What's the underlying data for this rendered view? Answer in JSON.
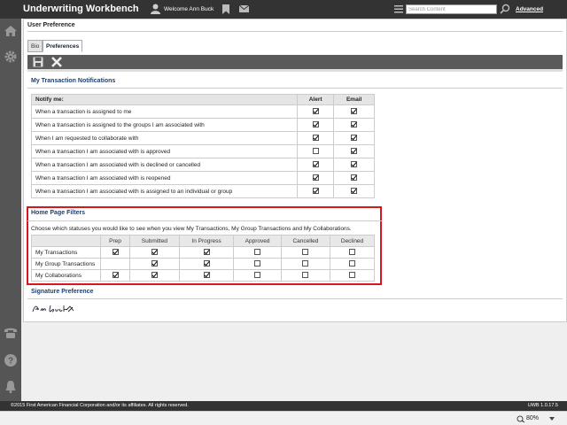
{
  "header": {
    "app_title": "Underwriting Workbench",
    "welcome": "Welcome Ann Buck",
    "search_placeholder": "Search Content",
    "advanced_label": "Advanced"
  },
  "nav_icons": [
    "home-icon",
    "gear-icon",
    "phone-icon",
    "help-icon",
    "bell-icon"
  ],
  "page": {
    "title": "User Preference",
    "tabs": [
      {
        "label": "Bio",
        "active": false
      },
      {
        "label": "Preferences",
        "active": true
      }
    ]
  },
  "notifications": {
    "title": "My Transaction Notifications",
    "headers": {
      "notify": "Notify me:",
      "alert": "Alert",
      "email": "Email"
    },
    "rows": [
      {
        "label": "When a transaction is assigned to me",
        "alert": true,
        "email": true
      },
      {
        "label": "When a transaction is assigned to the groups I am associated with",
        "alert": true,
        "email": true
      },
      {
        "label": "When I am requested to collaborate with",
        "alert": true,
        "email": true
      },
      {
        "label": "When a transaction I am associated with is approved",
        "alert": false,
        "email": true
      },
      {
        "label": "When a transaction I am associated with is declined or cancelled",
        "alert": true,
        "email": true
      },
      {
        "label": "When a transaction I am associated with is reopened",
        "alert": true,
        "email": true
      },
      {
        "label": "When a transaction I am associated with is assigned to an individual or group",
        "alert": true,
        "email": true
      }
    ]
  },
  "filters": {
    "title": "Home Page Filters",
    "description": "Choose which statuses you would like to see when you view My Transactions, My Group Transactions and My Collaborations.",
    "columns": [
      "Prep",
      "Submitted",
      "In Progress",
      "Approved",
      "Cancelled",
      "Declined"
    ],
    "rows": [
      {
        "label": "My Transactions",
        "values": [
          true,
          true,
          true,
          false,
          false,
          false
        ]
      },
      {
        "label": "My Group Transactions",
        "values": [
          null,
          true,
          true,
          false,
          false,
          false
        ]
      },
      {
        "label": "My Collaborations",
        "values": [
          true,
          true,
          true,
          false,
          false,
          false
        ]
      }
    ]
  },
  "signature": {
    "title": "Signature Preference",
    "name": "Ann Buck"
  },
  "footer": {
    "copyright": "©2015 First American Financial Corporation and/or its affiliates. All rights reserved.",
    "version": "UWB 1.0.17.5"
  },
  "statusbar": {
    "zoom": "80%"
  },
  "colors": {
    "highlight_border": "#d8161e",
    "section_title": "#1f3f6b",
    "topbar": "#333333"
  }
}
